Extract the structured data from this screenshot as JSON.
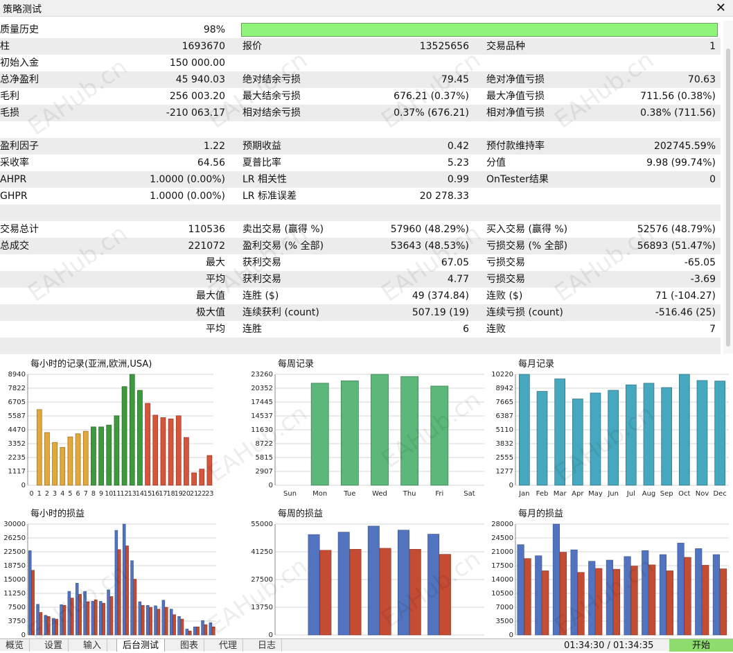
{
  "window": {
    "title": "策略测试"
  },
  "stats": [
    [
      {
        "l": "质量历史",
        "v": "98%"
      },
      {
        "bar": 0.98
      }
    ],
    [
      {
        "l": "柱",
        "v": "1693670"
      },
      {
        "l": "报价",
        "v": "13525656"
      },
      {
        "l": "交易品种",
        "v": "1"
      }
    ],
    [
      {
        "l": "初始入金",
        "v": "150 000.00"
      }
    ],
    [
      {
        "l": "总净盈利",
        "v": "45 940.03"
      },
      {
        "l": "绝对结余亏损",
        "v": "79.45"
      },
      {
        "l": "绝对净值亏损",
        "v": "70.63"
      }
    ],
    [
      {
        "l": "毛利",
        "v": "256 003.20"
      },
      {
        "l": "最大结余亏损",
        "v": "676.21 (0.37%)"
      },
      {
        "l": "最大净值亏损",
        "v": "711.56 (0.38%)"
      }
    ],
    [
      {
        "l": "毛损",
        "v": "-210 063.17"
      },
      {
        "l": "相对结余亏损",
        "v": "0.37% (676.21)"
      },
      {
        "l": "相对净值亏损",
        "v": "0.38% (711.56)"
      }
    ],
    [],
    [
      {
        "l": "盈利因子",
        "v": "1.22"
      },
      {
        "l": "预期收益",
        "v": "0.42"
      },
      {
        "l": "预付款维持率",
        "v": "202745.59%"
      }
    ],
    [
      {
        "l": "采收率",
        "v": "64.56"
      },
      {
        "l": "夏普比率",
        "v": "5.23"
      },
      {
        "l": "分值",
        "v": "9.98 (99.74%)"
      }
    ],
    [
      {
        "l": "AHPR",
        "v": "1.0000 (0.00%)"
      },
      {
        "l": "LR 相关性",
        "v": "0.99"
      },
      {
        "l": "OnTester结果",
        "v": "0"
      }
    ],
    [
      {
        "l": "GHPR",
        "v": "1.0000 (0.00%)"
      },
      {
        "l": "LR 标准误差",
        "v": "20 278.33"
      }
    ],
    [],
    [
      {
        "l": "交易总计",
        "v": "110536"
      },
      {
        "l": "卖出交易 (赢得 %)",
        "v": "57960 (48.29%)"
      },
      {
        "l": "买入交易 (赢得 %)",
        "v": "52576 (48.79%)"
      }
    ],
    [
      {
        "l": "总成交",
        "v": "221072"
      },
      {
        "l": "盈利交易 (% 全部)",
        "v": "53643 (48.53%)"
      },
      {
        "l": "亏损交易 (% 全部)",
        "v": "56893 (51.47%)"
      }
    ],
    [
      {
        "l": "",
        "v": "最大"
      },
      {
        "l": "获利交易",
        "v": "67.05"
      },
      {
        "l": "亏损交易",
        "v": "-65.05"
      }
    ],
    [
      {
        "l": "",
        "v": "平均"
      },
      {
        "l": "获利交易",
        "v": "4.77"
      },
      {
        "l": "亏损交易",
        "v": "-3.69"
      }
    ],
    [
      {
        "l": "",
        "v": "最大值"
      },
      {
        "l": "连胜 ($)",
        "v": "49 (374.84)"
      },
      {
        "l": "连败 ($)",
        "v": "71 (-104.27)"
      }
    ],
    [
      {
        "l": "",
        "v": "极大值"
      },
      {
        "l": "连续获利 (count)",
        "v": "507.19 (19)"
      },
      {
        "l": "连续亏损 (count)",
        "v": "-516.46 (25)"
      }
    ],
    [
      {
        "l": "",
        "v": "平均"
      },
      {
        "l": "连胜",
        "v": "6"
      },
      {
        "l": "连败",
        "v": "7"
      }
    ],
    []
  ],
  "chart_data": [
    {
      "type": "bar",
      "title": "每小时的记录(亚洲,欧洲,USA)",
      "categories": [
        "0",
        "1",
        "2",
        "3",
        "4",
        "5",
        "6",
        "7",
        "8",
        "9",
        "10",
        "11",
        "12",
        "13",
        "14",
        "15",
        "16",
        "17",
        "18",
        "19",
        "20",
        "21",
        "22",
        "23"
      ],
      "values": [
        0,
        6100,
        4250,
        3450,
        3050,
        3900,
        4150,
        4350,
        4700,
        4700,
        4850,
        5600,
        7950,
        8940,
        7650,
        6600,
        5650,
        5450,
        5350,
        5600,
        3850,
        1000,
        1300,
        2400
      ],
      "colors": [
        "#e2a93a",
        "#e2a93a",
        "#e2a93a",
        "#e2a93a",
        "#e2a93a",
        "#e2a93a",
        "#e2a93a",
        "#e2a93a",
        "#3d9a3d",
        "#3d9a3d",
        "#3d9a3d",
        "#3d9a3d",
        "#3d9a3d",
        "#3d9a3d",
        "#3d9a3d",
        "#d7553b",
        "#d7553b",
        "#d7553b",
        "#d7553b",
        "#d7553b",
        "#d7553b",
        "#d7553b",
        "#d7553b",
        "#d7553b"
      ],
      "yticks": [
        0,
        1117,
        2235,
        3352,
        4470,
        5587,
        6705,
        7822,
        8940
      ],
      "ylim": [
        0,
        8940
      ],
      "grid": true
    },
    {
      "type": "bar",
      "title": "每周记录",
      "categories": [
        "Sun",
        "Mon",
        "Tue",
        "Wed",
        "Thu",
        "Fri",
        "Sat"
      ],
      "values": [
        0,
        21400,
        21900,
        23260,
        22800,
        20800,
        0
      ],
      "colors": [
        "#5cb87a"
      ],
      "yticks": [
        0,
        2907,
        5815,
        8722,
        11630,
        14537,
        17445,
        20352,
        23260
      ],
      "ylim": [
        0,
        23260
      ],
      "grid": true
    },
    {
      "type": "bar",
      "title": "每月记录",
      "categories": [
        "Jan",
        "Feb",
        "Mar",
        "Apr",
        "May",
        "Jun",
        "Jul",
        "Aug",
        "Sep",
        "Oct",
        "Nov",
        "Dec"
      ],
      "values": [
        10220,
        8650,
        9800,
        7950,
        8500,
        8750,
        9250,
        9400,
        9000,
        10220,
        9650,
        9600
      ],
      "colors": [
        "#46a8bf"
      ],
      "yticks": [
        0,
        1277,
        2555,
        3832,
        5110,
        6387,
        7665,
        8942,
        10220
      ],
      "ylim": [
        0,
        10220
      ],
      "grid": true
    },
    {
      "type": "bar",
      "title": "每小时的损益",
      "categories": [
        "0",
        "1",
        "2",
        "3",
        "4",
        "5",
        "6",
        "7",
        "8",
        "9",
        "10",
        "11",
        "12",
        "13",
        "14",
        "15",
        "16",
        "17",
        "18",
        "19",
        "20",
        "21",
        "22",
        "23"
      ],
      "series": [
        {
          "values": [
            22800,
            8300,
            5300,
            4500,
            8200,
            11800,
            14000,
            11800,
            9100,
            9100,
            12200,
            28300,
            30000,
            20100,
            9000,
            8000,
            7900,
            9400,
            7000,
            5000,
            1600,
            2200,
            3900,
            3300
          ]
        },
        {
          "values": [
            17500,
            6100,
            5000,
            4300,
            8000,
            10000,
            11000,
            9000,
            9500,
            8600,
            10400,
            23100,
            24100,
            15100,
            8000,
            7500,
            7000,
            7500,
            5500,
            4300,
            1100,
            2200,
            2800,
            2200
          ]
        }
      ],
      "colors": [
        "#5273c0",
        "#c44c33"
      ],
      "yticks": [
        0,
        3750,
        7500,
        11250,
        15000,
        18750,
        22500,
        26250,
        30000
      ],
      "ylim": [
        0,
        30000
      ],
      "grid": true
    },
    {
      "type": "bar",
      "title": "每周的损益",
      "categories": [
        "Sun",
        "Mon",
        "Tue",
        "Wed",
        "Thu",
        "Fri",
        "Sat"
      ],
      "series": [
        {
          "values": [
            0,
            49800,
            51000,
            54000,
            52000,
            50000,
            0
          ]
        },
        {
          "values": [
            0,
            42000,
            42500,
            43000,
            42500,
            40000,
            0
          ]
        }
      ],
      "colors": [
        "#5273c0",
        "#c44c33"
      ],
      "yticks": [
        0,
        13750,
        27500,
        41250,
        55000
      ],
      "ylim": [
        0,
        55000
      ],
      "grid": true
    },
    {
      "type": "bar",
      "title": "每月的损益",
      "categories": [
        "Jan",
        "Feb",
        "Mar",
        "Apr",
        "May",
        "Jun",
        "Jul",
        "Aug",
        "Sep",
        "Oct",
        "Nov",
        "Dec"
      ],
      "series": [
        {
          "values": [
            22800,
            20000,
            28000,
            21500,
            18600,
            18900,
            19800,
            21300,
            20300,
            23200,
            21800,
            20300
          ]
        },
        {
          "values": [
            19300,
            16200,
            20900,
            15800,
            16800,
            16600,
            17400,
            17700,
            16200,
            19600,
            17600,
            16700
          ]
        }
      ],
      "colors": [
        "#5273c0",
        "#c44c33"
      ],
      "yticks": [
        0,
        3500,
        7000,
        10500,
        14000,
        17500,
        21000,
        24500,
        28000
      ],
      "ylim": [
        0,
        28000
      ],
      "grid": true
    }
  ],
  "tabs": [
    "概览",
    "设置",
    "输入",
    "后台测试",
    "图表",
    "代理",
    "日志"
  ],
  "active_tab": "后台测试",
  "footer": {
    "time": "01:34:30 / 01:34:35",
    "start_label": "开始"
  },
  "watermark": "EAHub.cn"
}
